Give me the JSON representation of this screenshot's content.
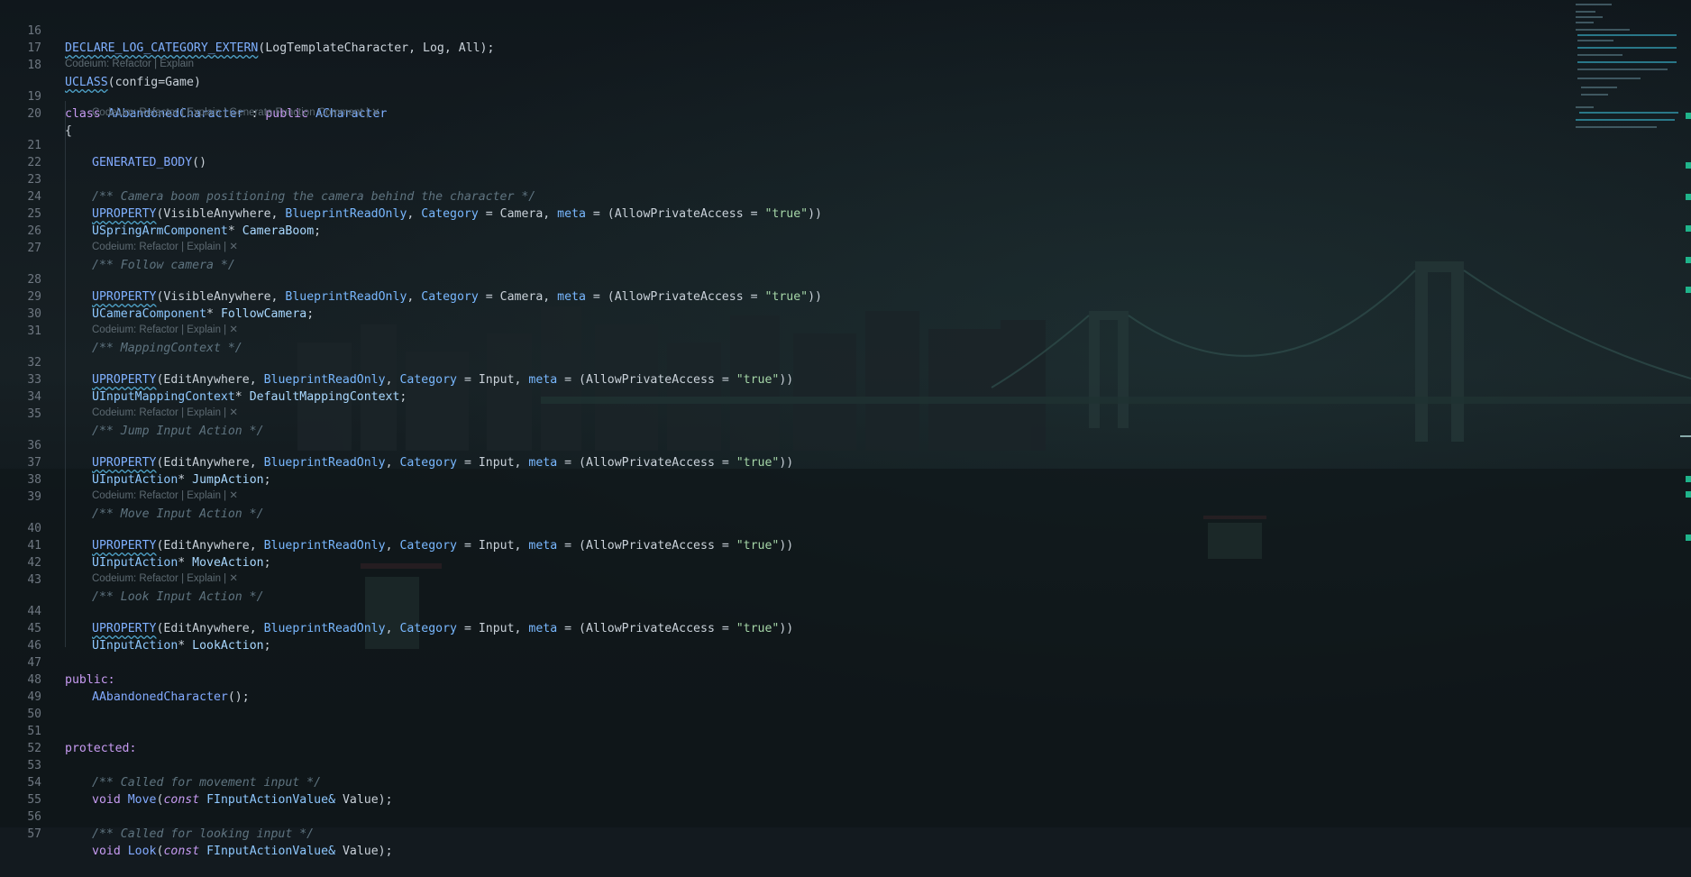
{
  "colors": {
    "background": "#131a1f",
    "keyword": "#c79bf2",
    "type": "#7fb0ff",
    "string": "#a5d6a7",
    "comment": "#5f7480",
    "line_number": "#6e7781",
    "codelens": "#5d6a72",
    "scroll_marker": "#1fb38a"
  },
  "lens": {
    "short": "Codeium: Refactor | Explain",
    "short_close": "Codeium: Refactor | Explain | ✕",
    "long": "Codeium: Refactor | Explain | Generate Function Comment | ✕"
  },
  "lines": {
    "16": {
      "n": "16"
    },
    "17": {
      "n": "17"
    },
    "18": {
      "n": "18"
    },
    "19": {
      "n": "19"
    },
    "20": {
      "n": "20"
    },
    "21": {
      "n": "21"
    },
    "22": {
      "n": "22"
    },
    "23": {
      "n": "23"
    },
    "24": {
      "n": "24"
    },
    "25": {
      "n": "25"
    },
    "26": {
      "n": "26"
    },
    "27": {
      "n": "27"
    },
    "28": {
      "n": "28"
    },
    "29": {
      "n": "29"
    },
    "30": {
      "n": "30"
    },
    "31": {
      "n": "31"
    },
    "32": {
      "n": "32"
    },
    "33": {
      "n": "33"
    },
    "34": {
      "n": "34"
    },
    "35": {
      "n": "35"
    },
    "36": {
      "n": "36"
    },
    "37": {
      "n": "37"
    },
    "38": {
      "n": "38"
    },
    "39": {
      "n": "39"
    },
    "40": {
      "n": "40"
    },
    "41": {
      "n": "41"
    },
    "42": {
      "n": "42"
    },
    "43": {
      "n": "43"
    },
    "44": {
      "n": "44"
    },
    "45": {
      "n": "45"
    },
    "46": {
      "n": "46"
    },
    "47": {
      "n": "47"
    },
    "48": {
      "n": "48"
    },
    "49": {
      "n": "49"
    },
    "50": {
      "n": "50"
    },
    "51": {
      "n": "51"
    },
    "52": {
      "n": "52"
    },
    "53": {
      "n": "53"
    },
    "54": {
      "n": "54"
    },
    "55": {
      "n": "55"
    },
    "56": {
      "n": "56"
    },
    "57": {
      "n": "57"
    }
  },
  "tok": {
    "declare_macro": "DECLARE_LOG_CATEGORY_EXTERN",
    "log_args": "LogTemplateCharacter, Log, All",
    "uclass": "UCLASS",
    "config_game": "config=Game",
    "class_kw": "class",
    "class_name": "AAbandonedCharacter",
    "colon": " : ",
    "public_kw": "public",
    "base_class": "ACharacter",
    "open_brace": "{",
    "generated_body": "GENERATED_BODY",
    "parens": "()",
    "c_camera_boom": "/** Camera boom positioning the camera behind the character */",
    "uproperty": "UPROPERTY",
    "visible_anywhere": "VisibleAnywhere",
    "edit_anywhere": "EditAnywhere",
    "blueprint_readonly": "BlueprintReadOnly",
    "category": "Category",
    "eq": " = ",
    "camera": "Camera",
    "input": "Input",
    "meta": "meta",
    "allow_private": "AllowPrivateAccess",
    "true_str": "\"true\"",
    "spring_arm": "USpringArmComponent",
    "star": "* ",
    "camera_boom": "CameraBoom",
    "semi": ";",
    "c_follow": "/** Follow camera */",
    "camera_comp": "UCameraComponent",
    "follow_camera": "FollowCamera",
    "c_mapping": "/** MappingContext */",
    "mapping_ctx": "UInputMappingContext",
    "default_mapping": "DefaultMappingContext",
    "c_jump": "/** Jump Input Action */",
    "input_action": "UInputAction",
    "jump_action": "JumpAction",
    "c_move": "/** Move Input Action */",
    "move_action": "MoveAction",
    "c_look": "/** Look Input Action */",
    "look_action": "LookAction",
    "public_label": "public:",
    "ctor": "AAbandonedCharacter",
    "ctor_tail": "();",
    "protected_label": "protected:",
    "c_move_input": "/** Called for movement input */",
    "void_kw": "void",
    "move_fn": "Move",
    "const_kw": "const",
    "fiav": "FInputActionValue&",
    "value": "Value",
    "fn_tail": ");",
    "c_look_input": "/** Called for looking input */",
    "look_fn": "Look"
  }
}
